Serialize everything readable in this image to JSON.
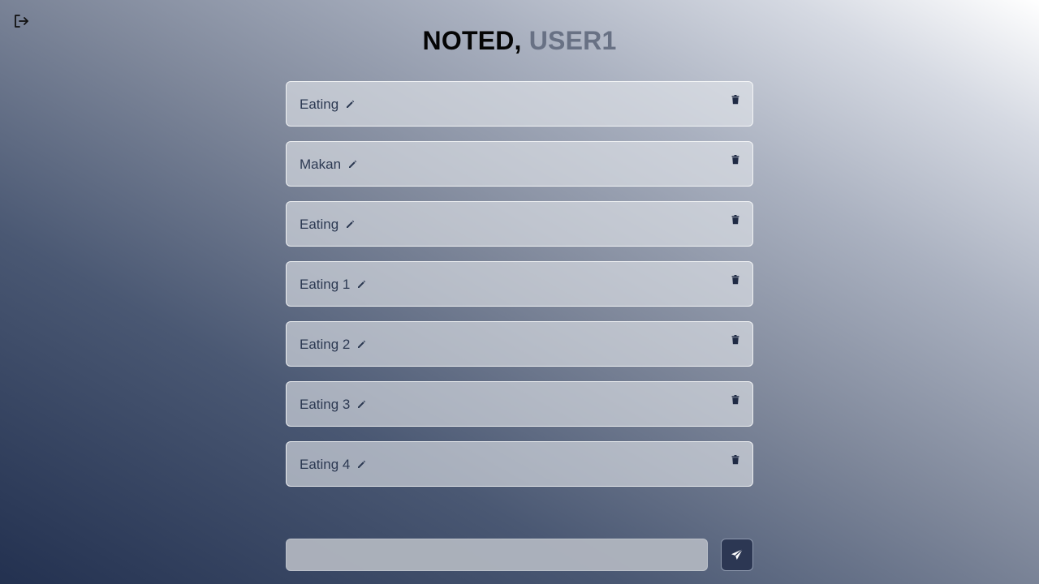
{
  "header": {
    "title_prefix": "NOTED,",
    "username": "USER1"
  },
  "icons": {
    "logout": "logout-icon",
    "edit": "pencil-icon",
    "delete": "trash-icon",
    "send": "paper-plane-icon"
  },
  "notes": [
    {
      "label": "Eating"
    },
    {
      "label": "Makan"
    },
    {
      "label": "Eating"
    },
    {
      "label": "Eating 1"
    },
    {
      "label": "Eating 2"
    },
    {
      "label": "Eating 3"
    },
    {
      "label": "Eating 4"
    }
  ],
  "composer": {
    "value": "",
    "placeholder": ""
  },
  "colors": {
    "title": "#050505",
    "username": "#687184",
    "note_text": "#2d3a53",
    "send_button": "#2c3753"
  }
}
